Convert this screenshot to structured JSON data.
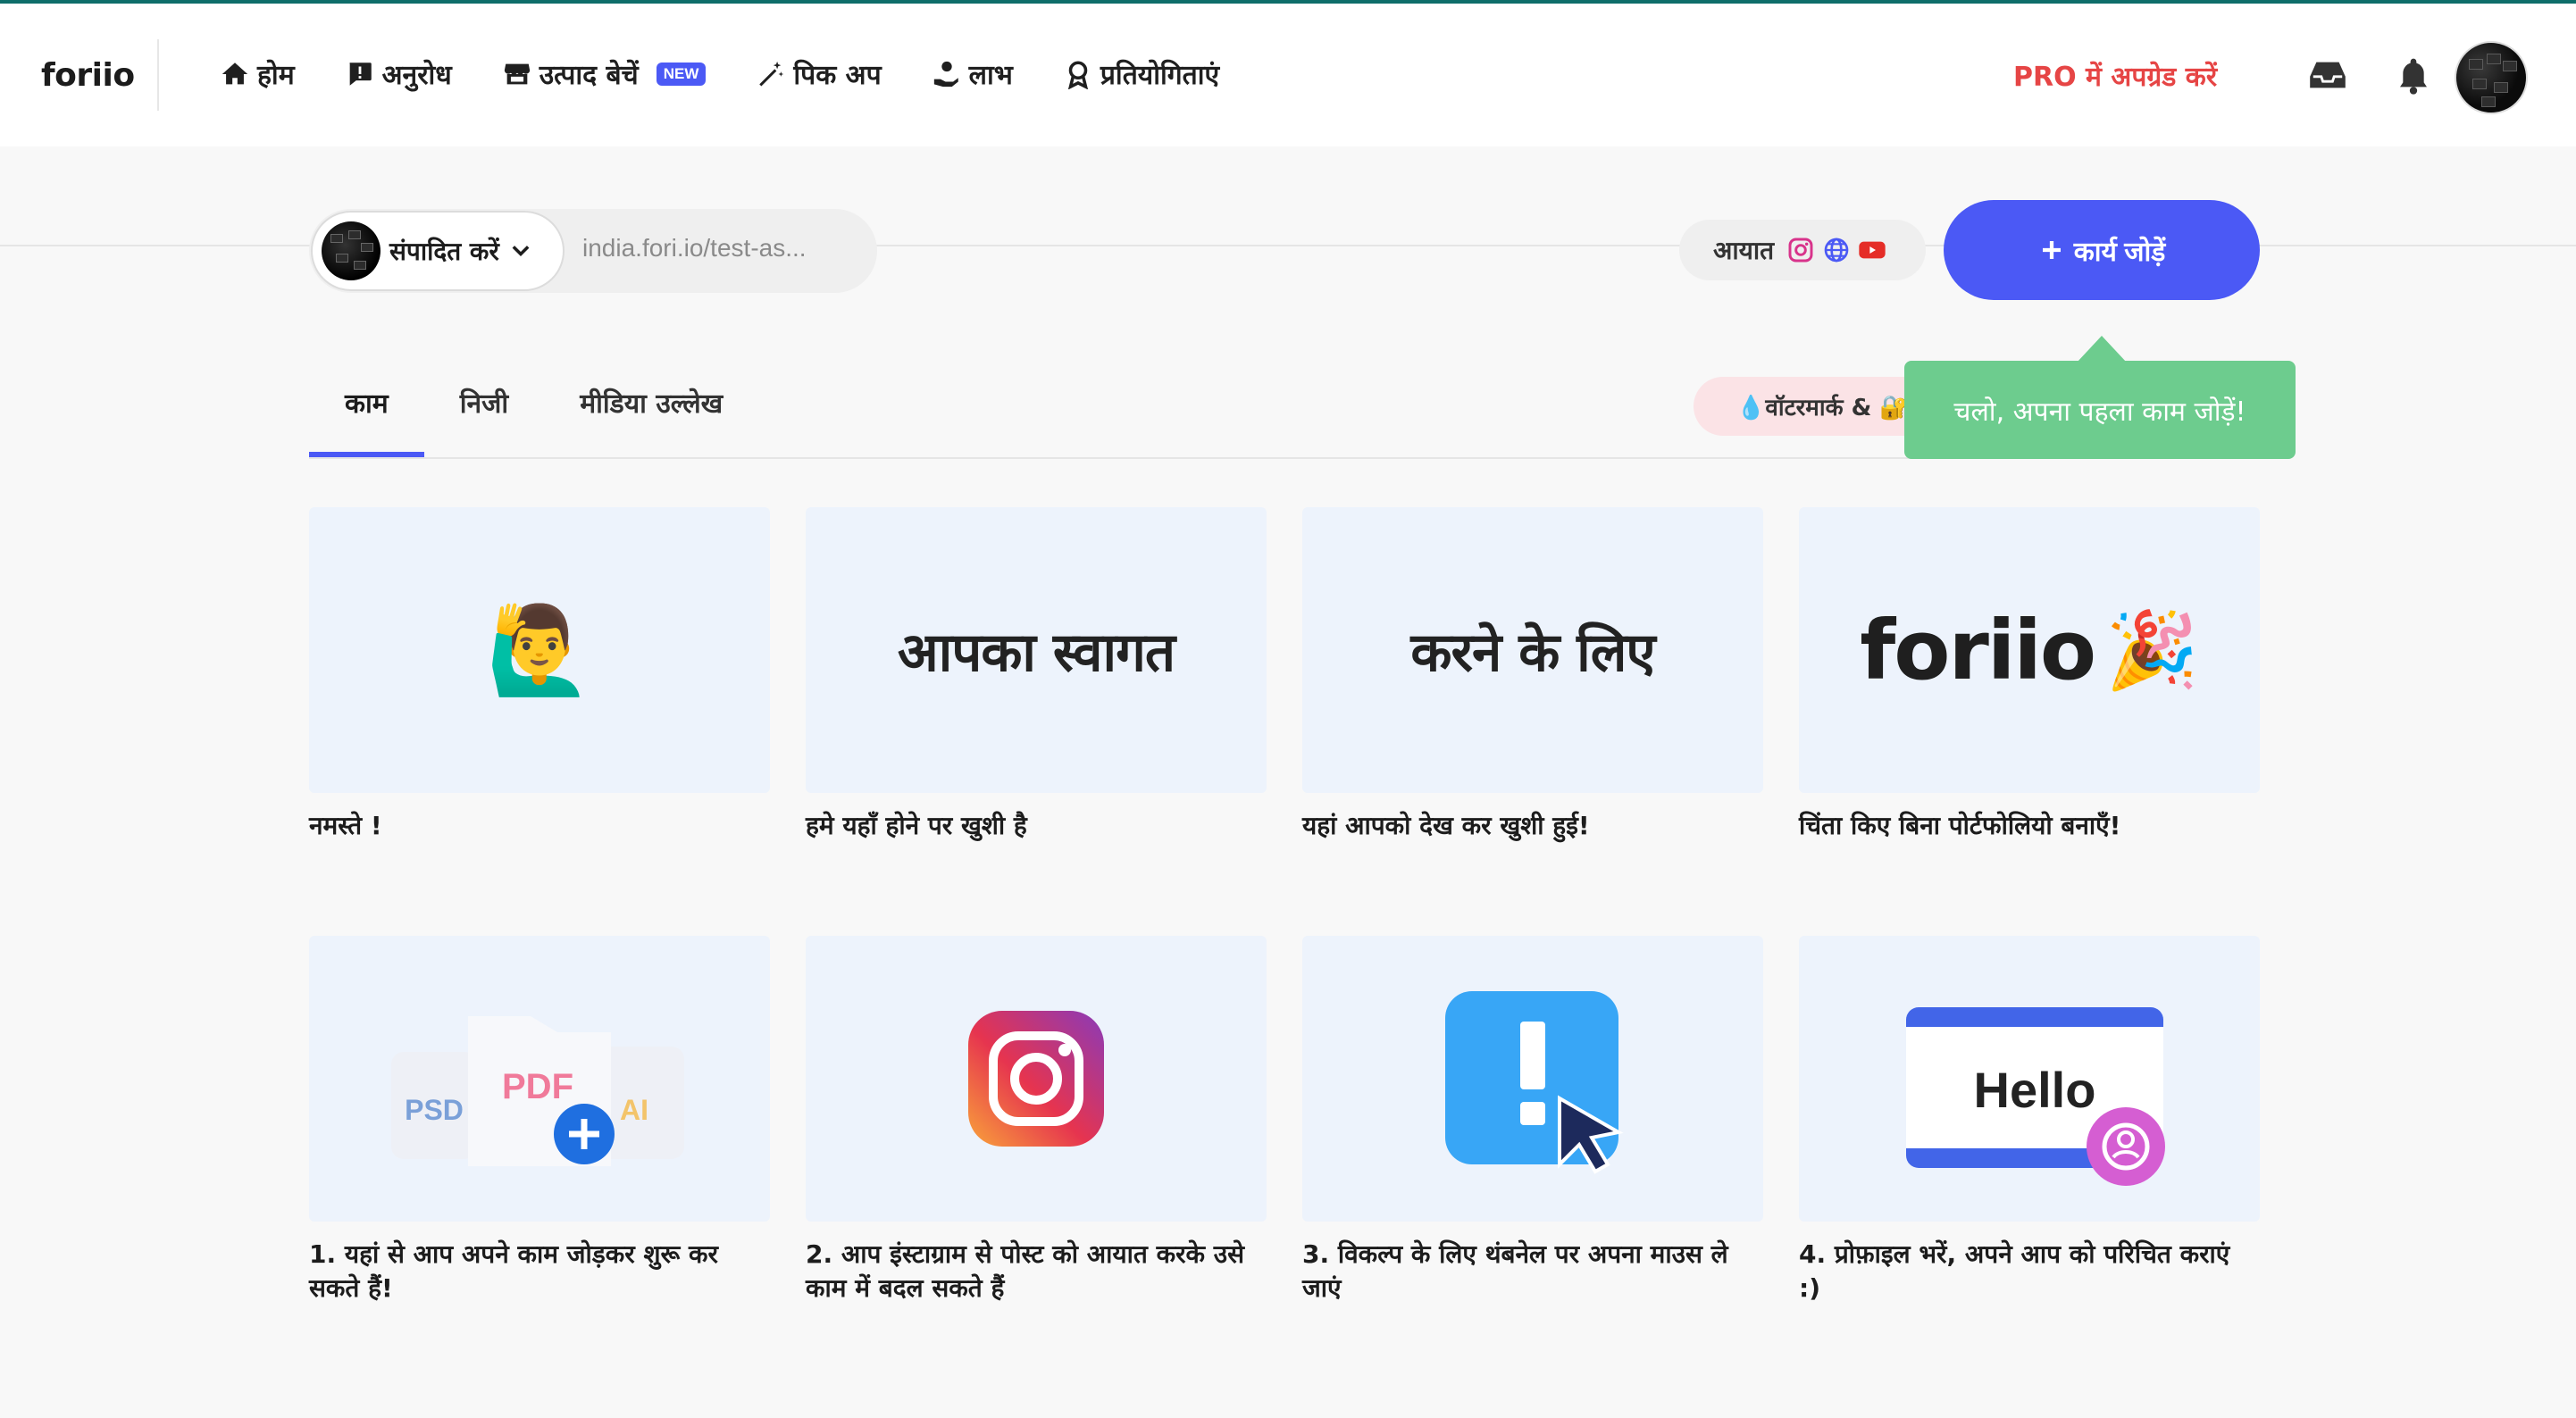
{
  "brand": {
    "logo_text": "foriio"
  },
  "nav": {
    "items": [
      {
        "label": "होम",
        "icon": "home-icon"
      },
      {
        "label": "अनुरोध",
        "icon": "request-icon"
      },
      {
        "label": "उत्पाद बेचें",
        "icon": "store-icon",
        "badge": "NEW"
      },
      {
        "label": "पिक अप",
        "icon": "magic-wand-icon"
      },
      {
        "label": "लाभ",
        "icon": "benefit-hand-icon"
      },
      {
        "label": "प्रतियोगिताएं",
        "icon": "award-icon"
      }
    ],
    "upgrade_label": "PRO में अपग्रेड करें"
  },
  "profile_bar": {
    "edit_label": "संपादित करें",
    "url": "india.fori.io/test-as...",
    "import_label": "आयात",
    "add_work_label": "कार्य जोड़ें"
  },
  "tabs": [
    {
      "label": "काम",
      "active": true
    },
    {
      "label": "निजी",
      "active": false
    },
    {
      "label": "मीडिया उल्लेख",
      "active": false
    }
  ],
  "watermark_label": "💧वॉटरमार्क & 🔐",
  "tooltip_text": "चलो, अपना पहला काम जोड़ें!",
  "cards": [
    {
      "thumb_text": "🙋‍♂️",
      "caption": "नमस्ते !"
    },
    {
      "thumb_text": "आपका स्वागत",
      "caption": "हमे यहाँ होने पर खुशी है"
    },
    {
      "thumb_text": "करने के लिए",
      "caption": "यहां आपको देख कर खुशी हुई!"
    },
    {
      "thumb_text": "foriio",
      "thumb_emoji": "🎉",
      "caption": "चिंता किए बिना पोर्टफोलियो बनाएँ!"
    },
    {
      "thumb_labels": [
        "PSD",
        "PDF",
        "AI"
      ],
      "caption": "1. यहां से आप अपने काम जोड़कर शुरू कर सकते हैं!"
    },
    {
      "caption": "2. आप इंस्टाग्राम से पोस्ट को आयात करके उसे काम में बदल सकते हैं"
    },
    {
      "caption": "3. विकल्प के लिए थंबनेल पर अपना माउस ले जाएं"
    },
    {
      "thumb_text": "Hello",
      "caption": "4. प्रोफ़ाइल भरें, अपने आप को परिचित कराएं :)"
    }
  ],
  "colors": {
    "accent": "#4b59f5",
    "upgrade": "#e64545",
    "tooltip": "#6dcc8e",
    "card_bg": "#edf3fc"
  }
}
